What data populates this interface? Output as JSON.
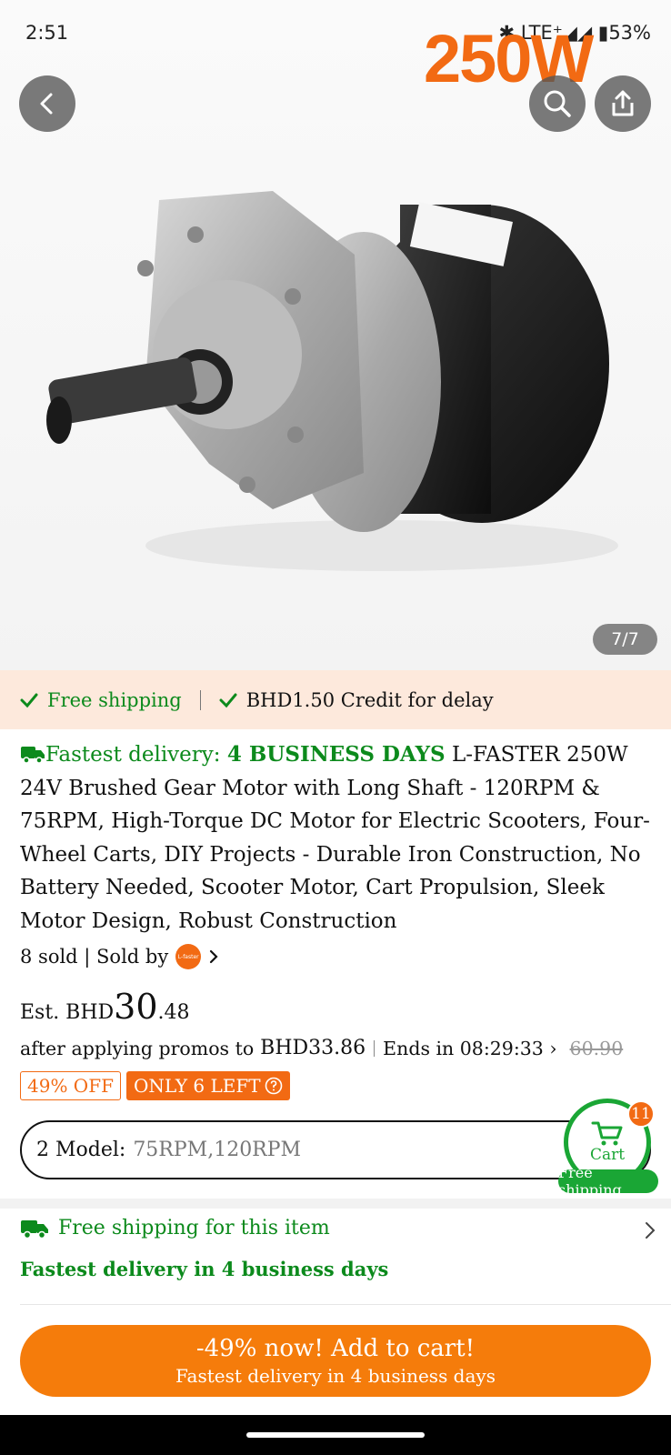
{
  "status": {
    "time": "2:51",
    "indicators": "✱ LTE⁺◢◢ ▮53%"
  },
  "hero": {
    "watermark": "250W",
    "page_indicator": "7/7",
    "icons": [
      "back-arrow-icon",
      "search-icon",
      "share-icon"
    ]
  },
  "shipping_banner": {
    "free_shipping": "Free shipping",
    "credit": "BHD1.50 Credit for delay"
  },
  "title": {
    "fast_prefix": "Fastest delivery: ",
    "fast_days": "4 BUSINESS DAYS",
    "text": " L-FASTER 250W 24V Brushed Gear Motor with Long Shaft - 120RPM & 75RPM, High-Torque DC Motor for Electric Scooters, Four-Wheel Carts, DIY Projects - Durable Iron Construction, No Battery Needed, Scooter Motor, Cart Propulsion, Sleek Motor Design, Robust Construction"
  },
  "sold": {
    "text": "8 sold | Sold by",
    "seller_logo": "L-faster"
  },
  "price": {
    "est": "Est. BHD",
    "whole": "30",
    "cents": ".48",
    "after_promos": "after applying promos to",
    "promo_amount": "BHD33.86",
    "ends_in": "Ends in 08:29:33 ›",
    "original": "60.90"
  },
  "badges": {
    "off": "49% OFF",
    "left": "ONLY 6 LEFT"
  },
  "model": {
    "label": "2 Model:",
    "value": "75RPM,120RPM"
  },
  "cart": {
    "count": "11",
    "label": "Cart",
    "free_shipping": "Free shipping"
  },
  "shipping_info": {
    "line1": "Free shipping for this item",
    "line2": "Fastest delivery in 4 business days"
  },
  "add_button": {
    "line1": "-49% now! Add to cart!",
    "line2": "Fastest delivery in 4 business days"
  },
  "colors": {
    "accent": "#f57c0b",
    "green": "#0c8a1c",
    "banner_bg": "#fde9dc"
  }
}
